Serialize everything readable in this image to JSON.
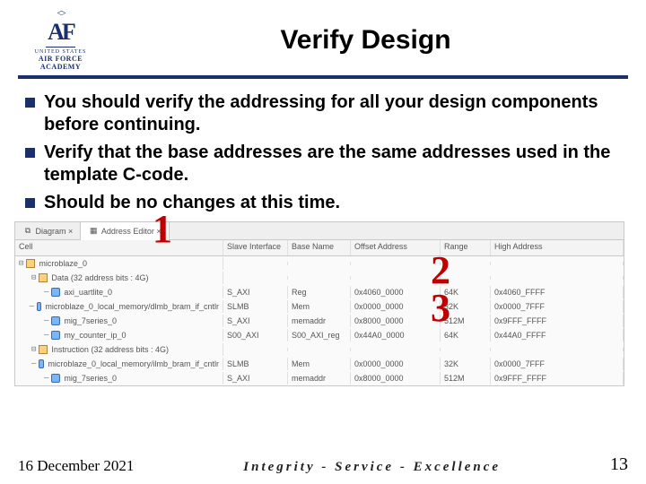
{
  "logo": {
    "top": "AF",
    "line1": "UNITED STATES",
    "line2": "AIR FORCE",
    "line3": "ACADEMY"
  },
  "title": "Verify Design",
  "bullets": [
    "You should verify the addressing for all your design components before continuing.",
    "Verify that the base addresses are the same addresses used in the template C-code.",
    "Should be no changes at this time."
  ],
  "annotations": {
    "a1": "1",
    "a2": "2",
    "a3": "3"
  },
  "panel": {
    "tabs": {
      "diagram": "Diagram",
      "addr": "Address Editor"
    },
    "columns": {
      "cell": "Cell",
      "slave": "Slave Interface",
      "base": "Base Name",
      "offset": "Offset Address",
      "range": "Range",
      "high": "High Address"
    },
    "rows": [
      {
        "indent": 0,
        "twisty": "⊟",
        "icon": "chip",
        "cell": "microblaze_0"
      },
      {
        "indent": 1,
        "twisty": "⊟",
        "icon": "chip",
        "cell": "Data (32 address bits : 4G)"
      },
      {
        "indent": 2,
        "twisty": "—",
        "icon": "bus",
        "cell": "axi_uartlite_0",
        "slave": "S_AXI",
        "base": "Reg",
        "offset": "0x4060_0000",
        "range": "64K",
        "high": "0x4060_FFFF"
      },
      {
        "indent": 2,
        "twisty": "—",
        "icon": "bus",
        "cell": "microblaze_0_local_memory/dlmb_bram_if_cntlr",
        "slave": "SLMB",
        "base": "Mem",
        "offset": "0x0000_0000",
        "range": "32K",
        "high": "0x0000_7FFF"
      },
      {
        "indent": 2,
        "twisty": "—",
        "icon": "bus",
        "cell": "mig_7series_0",
        "slave": "S_AXI",
        "base": "memaddr",
        "offset": "0x8000_0000",
        "range": "512M",
        "high": "0x9FFF_FFFF"
      },
      {
        "indent": 2,
        "twisty": "—",
        "icon": "bus",
        "cell": "my_counter_ip_0",
        "slave": "S00_AXI",
        "base": "S00_AXI_reg",
        "offset": "0x44A0_0000",
        "range": "64K",
        "high": "0x44A0_FFFF"
      },
      {
        "indent": 1,
        "twisty": "⊟",
        "icon": "chip",
        "cell": "Instruction (32 address bits : 4G)"
      },
      {
        "indent": 2,
        "twisty": "—",
        "icon": "bus",
        "cell": "microblaze_0_local_memory/ilmb_bram_if_cntlr",
        "slave": "SLMB",
        "base": "Mem",
        "offset": "0x0000_0000",
        "range": "32K",
        "high": "0x0000_7FFF"
      },
      {
        "indent": 2,
        "twisty": "—",
        "icon": "bus",
        "cell": "mig_7series_0",
        "slave": "S_AXI",
        "base": "memaddr",
        "offset": "0x8000_0000",
        "range": "512M",
        "high": "0x9FFF_FFFF"
      }
    ]
  },
  "footer": {
    "date": "16 December 2021",
    "motto": "Integrity - Service - Excellence",
    "page": "13"
  }
}
